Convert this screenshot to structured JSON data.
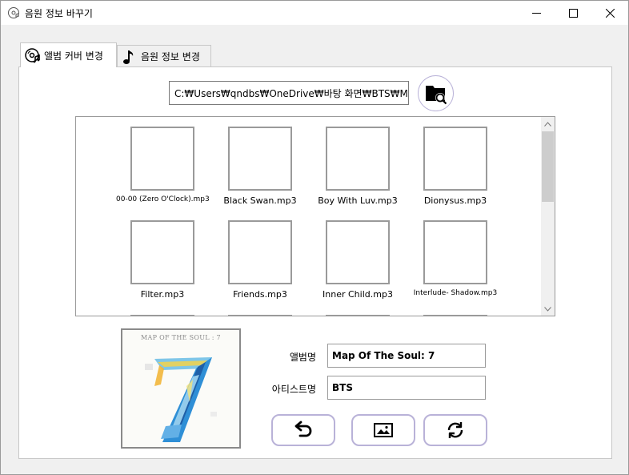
{
  "window": {
    "title": "음원 정보 바꾸기"
  },
  "tabs": [
    {
      "label": "앨범 커버 변경",
      "icon": "album-disc-icon",
      "active": true
    },
    {
      "label": "음원 정보 변경",
      "icon": "music-note-icon",
      "active": false
    }
  ],
  "path": {
    "value": "C:₩Users₩qndbs₩OneDrive₩바탕 화면₩BTS₩Map O"
  },
  "files": [
    {
      "name": "00-00 (Zero O'Clock).mp3"
    },
    {
      "name": "Black Swan.mp3"
    },
    {
      "name": "Boy With Luv.mp3"
    },
    {
      "name": "Dionysus.mp3"
    },
    {
      "name": "Filter.mp3"
    },
    {
      "name": "Friends.mp3"
    },
    {
      "name": "Inner Child.mp3"
    },
    {
      "name": "Interlude- Shadow.mp3"
    }
  ],
  "cover": {
    "title": "MAP OF THE SOUL : 7"
  },
  "fields": {
    "album_label": "앨범명",
    "album_value": "Map Of The Soul: 7",
    "artist_label": "아티스트명",
    "artist_value": "BTS"
  },
  "actions": [
    {
      "icon": "undo-icon"
    },
    {
      "icon": "image-icon"
    },
    {
      "icon": "refresh-icon"
    }
  ],
  "colors": {
    "button_border": "#b9b2d8",
    "accent_blue": "#2f8fd6"
  }
}
